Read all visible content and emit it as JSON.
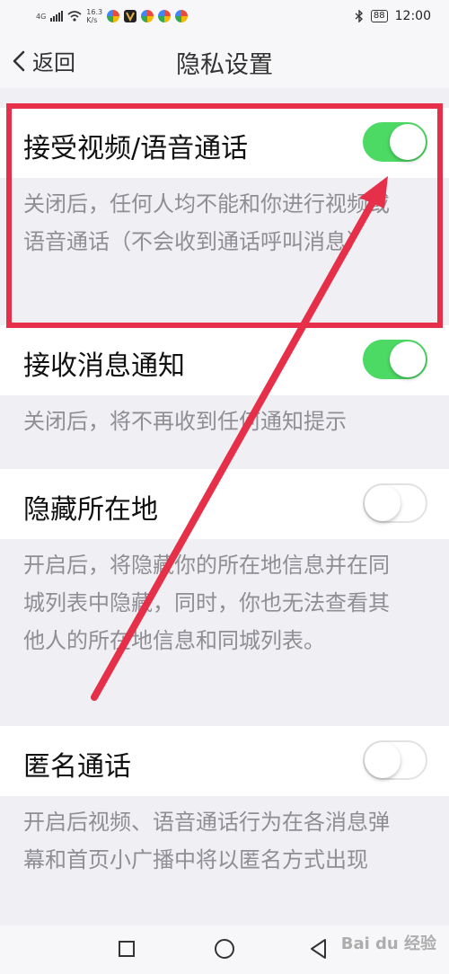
{
  "status_bar": {
    "network": "4G",
    "speed_value": "16.3",
    "speed_unit": "K/s",
    "battery": "88",
    "time": "12:00"
  },
  "header": {
    "back_label": "返回",
    "title": "隐私设置"
  },
  "settings": [
    {
      "label": "接受视频/语音通话",
      "enabled": true,
      "description": "关闭后，任何人均不能和你进行视频或语音通话（不会收到通话呼叫消息）"
    },
    {
      "label": "接收消息通知",
      "enabled": true,
      "description": "关闭后，将不再收到任何通知提示"
    },
    {
      "label": "隐藏所在地",
      "enabled": false,
      "description": "开启后，将隐藏你的所在地信息并在同城列表中隐藏，同时，你也无法查看其他人的所在地信息和同城列表。"
    },
    {
      "label": "匿名通话",
      "enabled": false,
      "description": "开启后视频、语音通话行为在各消息弹幕和首页小广播中将以匿名方式出现"
    }
  ],
  "annotation": {
    "color": "#e6304a"
  },
  "colors": {
    "toggle_on": "#4cd964",
    "background": "#efeff4"
  },
  "watermark": "Bai du 经验"
}
